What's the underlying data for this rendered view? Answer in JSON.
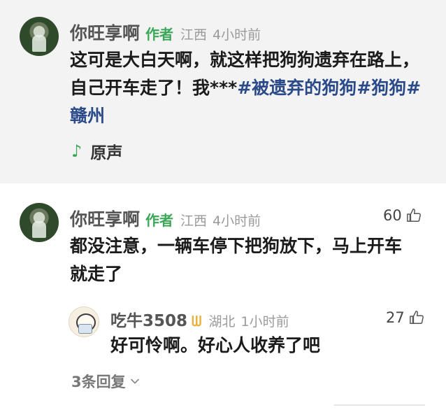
{
  "post": {
    "author_name": "你旺享啊",
    "author_tag": "作者",
    "location": "江西",
    "time": "4小时前",
    "text_lines": [
      "这可是大白天啊，就这样把狗狗遗弃在路上，",
      "自己开车走了！我***"
    ],
    "tags": [
      "#被遗弃的狗狗",
      "#狗狗",
      "#",
      "赣州"
    ],
    "sound_label": "原声"
  },
  "comment": {
    "author_name": "你旺享啊",
    "author_tag": "作者",
    "location": "江西",
    "time": "4小时前",
    "like_count": "60",
    "text_lines": [
      "都没注意，一辆车停下把狗放下，马上开车",
      "就走了"
    ]
  },
  "reply": {
    "author_name": "吃牛3508",
    "location": "湖北",
    "time": "1小时前",
    "like_count": "27",
    "text": "好可怜啊。好心人收养了吧"
  },
  "more_replies_label": "3条回复",
  "colors": {
    "accent_green": "#3aa757",
    "tag_blue": "#2b4a8a",
    "badge_gold": "#e8b23a"
  },
  "icons": {
    "note": "music-note-icon",
    "thumb": "thumb-up-icon",
    "chevron": "chevron-down-icon",
    "badge": "fan-badge-icon"
  }
}
